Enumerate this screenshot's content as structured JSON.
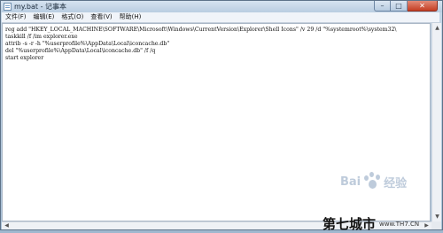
{
  "window": {
    "title": "my.bat - 记事本"
  },
  "menu": [
    "文件(F)",
    "编辑(E)",
    "格式(O)",
    "查看(V)",
    "帮助(H)"
  ],
  "editor": {
    "lines": [
      "reg add \"HKEY_LOCAL_MACHINE\\SOFTWARE\\Microsoft\\Windows\\CurrentVersion\\Explorer\\Shell Icons\" /v 29 /d \"%systemroot%\\system32\\",
      "taskkill /f /im explorer.exe",
      "attrib -s -r -h \"%userprofile%\\AppData\\Local\\iconcache.db\"",
      "del \"%userprofile%\\AppData\\Local\\iconcache.db\" /f /q",
      "start explorer"
    ]
  },
  "watermarks": {
    "baidu_text_1": "Bai",
    "baidu_text_2": "经验",
    "site_cn": "第七城市",
    "site_en": "www.TH7.CN"
  },
  "colors": {
    "titlebar": "#c6d7e8",
    "close_button": "#c43d22"
  }
}
